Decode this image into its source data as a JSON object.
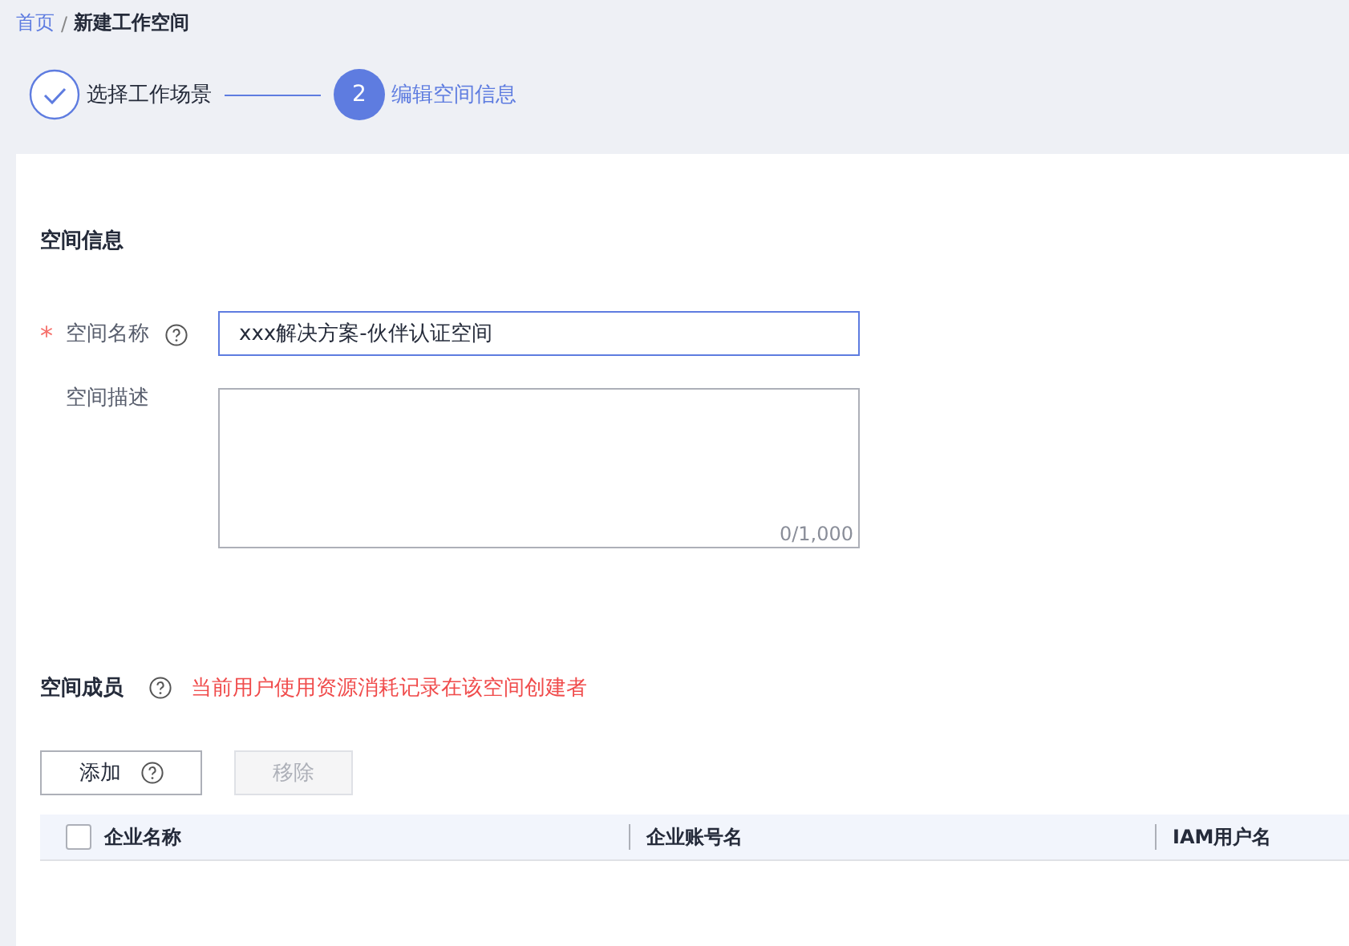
{
  "breadcrumb": [
    {
      "label": "首页",
      "link": true
    },
    {
      "label": "新建工作空间",
      "link": false
    }
  ],
  "breadcrumb_separator": "/",
  "steps": [
    {
      "kind": "done",
      "label": "选择工作场景"
    },
    {
      "kind": "current",
      "number": "2",
      "label": "编辑空间信息"
    }
  ],
  "info_section": {
    "title": "空间信息",
    "fields": [
      {
        "kind": "input",
        "label": "空间名称",
        "required_mark": "*",
        "help": true,
        "value": "xxx解决方案-伙伴认证空间",
        "focused": true
      },
      {
        "kind": "textarea",
        "label": "空间描述",
        "help": false,
        "counter": "0/1,000",
        "focused": false
      }
    ]
  },
  "members_section": {
    "title": "空间成员",
    "note": "当前用户使用资源消耗记录在该空间创建者",
    "buttons": [
      {
        "label": "添加",
        "help": true,
        "disabled": false
      },
      {
        "label": "移除",
        "help": false,
        "disabled": true
      }
    ],
    "table": {
      "select_all": {
        "checked": false
      },
      "columns": [
        "企业名称",
        "企业账号名",
        "IAM用户名"
      ]
    }
  }
}
